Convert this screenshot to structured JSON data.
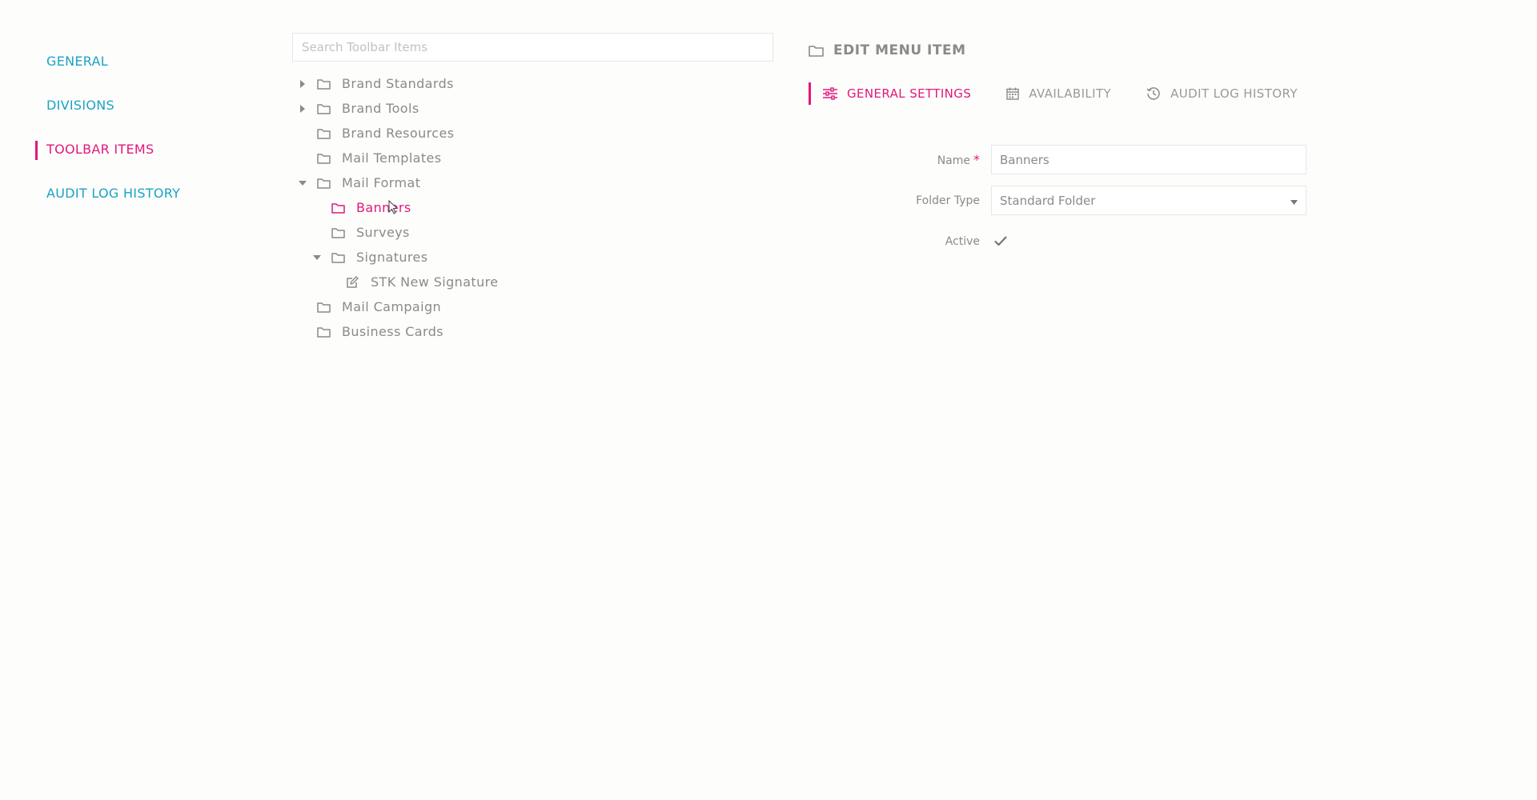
{
  "sidebar": {
    "items": [
      {
        "label": "GENERAL"
      },
      {
        "label": "DIVISIONS"
      },
      {
        "label": "TOOLBAR ITEMS"
      },
      {
        "label": "AUDIT LOG HISTORY"
      }
    ]
  },
  "search": {
    "placeholder": "Search Toolbar Items"
  },
  "tree": {
    "items": [
      {
        "label": "Brand Standards",
        "toggle": "collapsed",
        "icon": "folder-icon"
      },
      {
        "label": "Brand Tools",
        "toggle": "collapsed",
        "icon": "folder-icon"
      },
      {
        "label": "Brand Resources",
        "toggle": "none",
        "icon": "folder-icon"
      },
      {
        "label": "Mail Templates",
        "toggle": "none",
        "icon": "folder-icon"
      },
      {
        "label": "Mail Format",
        "toggle": "expanded",
        "icon": "folder-icon"
      },
      {
        "label": "Banners",
        "toggle": "none",
        "icon": "folder-icon",
        "selected": true
      },
      {
        "label": "Surveys",
        "toggle": "none",
        "icon": "folder-icon"
      },
      {
        "label": "Signatures",
        "toggle": "expanded",
        "icon": "folder-icon"
      },
      {
        "label": "STK New Signature",
        "toggle": "none",
        "icon": "edit-icon"
      },
      {
        "label": "Mail Campaign",
        "toggle": "none",
        "icon": "folder-icon"
      },
      {
        "label": "Business Cards",
        "toggle": "none",
        "icon": "folder-icon"
      }
    ]
  },
  "panel": {
    "title": "EDIT MENU ITEM",
    "title_icon": "folder-icon",
    "tabs": [
      {
        "label": "GENERAL SETTINGS",
        "icon": "sliders-icon"
      },
      {
        "label": "AVAILABILITY",
        "icon": "calendar-icon"
      },
      {
        "label": "AUDIT LOG HISTORY",
        "icon": "history-icon"
      }
    ]
  },
  "form": {
    "name_label": "Name",
    "required_mark": "*",
    "name_value": "Banners",
    "folder_type_label": "Folder Type",
    "folder_type_value": "Standard Folder",
    "active_label": "Active",
    "active_checked": true
  },
  "colors": {
    "accent": "#e0197a",
    "link": "#1aa3c4",
    "text": "#8a8a8a",
    "border": "#e6e6e6"
  }
}
